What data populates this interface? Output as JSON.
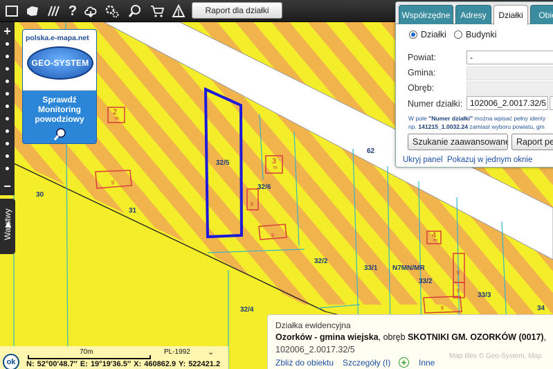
{
  "toolbar": {
    "icons": [
      "square-icon",
      "map-icon",
      "hatch-icon",
      "help-icon",
      "cloud-icon",
      "settings-icon",
      "search-zoom-icon",
      "cart-icon",
      "measure-icon"
    ],
    "report_button": "Raport dla działki"
  },
  "zoom": {
    "plus": "+",
    "minus": "−"
  },
  "layers_tab": "Warstwy",
  "banner": {
    "site": "polska.e-mapa.net",
    "logo": "GEO-SYSTEM",
    "line1": "Sprawdź",
    "line2": "Monitoring",
    "line3": "powodziowy"
  },
  "map": {
    "parcels": {
      "p30": "30",
      "p31": "31",
      "p32_5": "32/5",
      "p32_6": "32/6",
      "p62": "62",
      "p32_2": "32/2",
      "p33_1": "33/1",
      "p32_4": "32/4",
      "p33_2": "33/2",
      "p33_3": "33/3",
      "p34": "34",
      "zone": "N7MN/MR"
    },
    "buildings": {
      "b2": "2",
      "b3": "3",
      "b4": "4",
      "g": "g",
      "m": "m"
    }
  },
  "panel": {
    "tabs": [
      "Współrzędne",
      "Adresy",
      "Działki",
      "Obie"
    ],
    "active_tab": "Działki",
    "radio_parcels": "Działki",
    "radio_buildings": "Budynki",
    "labels": {
      "powiat": "Powiat:",
      "gmina": "Gmina:",
      "obreb": "Obręb:",
      "numer": "Numer działki:"
    },
    "values": {
      "powiat": "-",
      "numer": "102006_2.0017.32/5"
    },
    "hint": {
      "p1": "W pole ",
      "b1": "\"Numer działki\"",
      "p2": " można wpisać pełny identy",
      "p3": "np. ",
      "b2": "141215_1.0032.24",
      "p4": " zamiast wyboru powiatu, gm"
    },
    "search_button": "Szukanie zaawansowane",
    "report_button": "Raport pel",
    "hide_link": "Ukryj panel",
    "show_link": "Pokazuj w jednym oknie"
  },
  "info": {
    "title": "Działka ewidencyjna",
    "place": "Ozorków - gmina wiejska",
    "sep": ", obręb ",
    "obreb": "SKOTNIKI GM. OZORKÓW (0017)",
    "tail": ",",
    "id": "102006_2.0017.32/5",
    "zoom_link": "Zbliż do obiektu",
    "details_link": "Szczegóły (I)",
    "plus": "+",
    "more_link": "Inne"
  },
  "attribution": "Map tiles © Geo-System, Map",
  "status": {
    "ok": "ok",
    "scale": "70m",
    "projection": "PL-1992",
    "coords": "N: 52°00'48.7″  E: 19°19'36.5″  X: 460862.9  Y: 522421.2"
  }
}
